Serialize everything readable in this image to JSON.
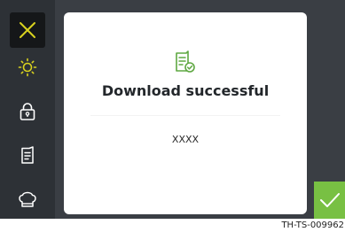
{
  "colors": {
    "screen_bg": "#3a3e44",
    "sidebar_bg": "#2d3136",
    "active_item_bg": "#151719",
    "accent_yellow": "#d9d21e",
    "success_green": "#5fa842",
    "confirm_green": "#78c043"
  },
  "sidebar": {
    "items": [
      {
        "icon": "close-icon",
        "active": true
      },
      {
        "icon": "brightness-icon",
        "active": false
      },
      {
        "icon": "lock-icon",
        "active": false
      },
      {
        "icon": "document-icon",
        "active": false
      },
      {
        "icon": "chef-hat-icon",
        "active": false
      }
    ]
  },
  "dialog": {
    "icon": "document-check-icon",
    "title": "Download successful",
    "message": "XXXX"
  },
  "confirm_button": {
    "icon": "checkmark-icon"
  },
  "footer": {
    "code": "TH-TS-009962"
  }
}
